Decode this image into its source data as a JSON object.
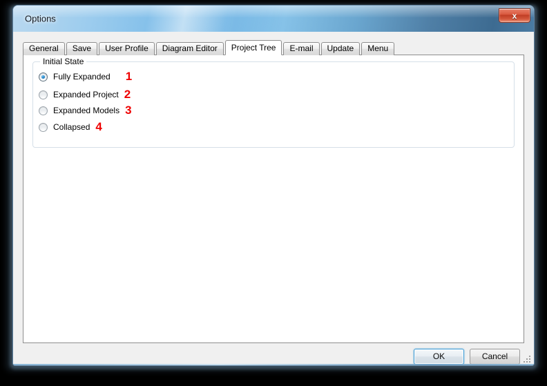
{
  "window": {
    "title": "Options",
    "close_icon": "close-x-icon",
    "close_label": "x"
  },
  "tabs": [
    {
      "label": "General",
      "active": false
    },
    {
      "label": "Save",
      "active": false
    },
    {
      "label": "User Profile",
      "active": false
    },
    {
      "label": "Diagram Editor",
      "active": false
    },
    {
      "label": "Project Tree",
      "active": true
    },
    {
      "label": "E-mail",
      "active": false
    },
    {
      "label": "Update",
      "active": false
    },
    {
      "label": "Menu",
      "active": false
    }
  ],
  "group": {
    "label": "Initial State",
    "options": [
      {
        "label": "Fully Expanded",
        "checked": true,
        "annotation": "1"
      },
      {
        "label": "Expanded Project",
        "checked": false,
        "annotation": "2"
      },
      {
        "label": "Expanded Models",
        "checked": false,
        "annotation": "3"
      },
      {
        "label": "Collapsed",
        "checked": false,
        "annotation": "4"
      }
    ]
  },
  "footer": {
    "ok_label": "OK",
    "cancel_label": "Cancel"
  },
  "colors": {
    "annotation_red": "#ee0000",
    "titlebar_blue": "#7ebde9",
    "focus_blue": "#3c9ad4",
    "close_red": "#bf3d24"
  }
}
